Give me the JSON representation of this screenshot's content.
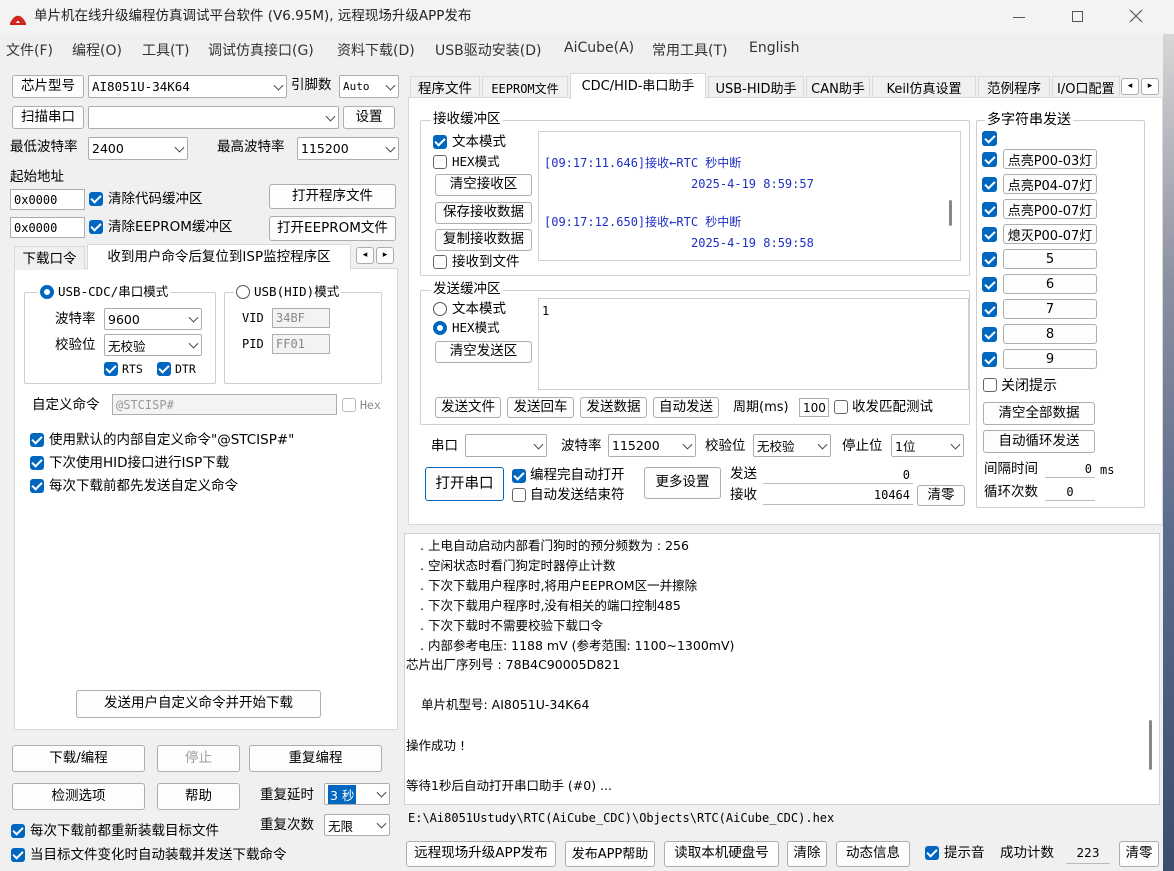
{
  "title": "单片机在线升级编程仿真调试平台软件 (V6.95M), 远程现场升级APP发布",
  "menu": [
    "文件(F)",
    "编程(O)",
    "工具(T)",
    "调试仿真接口(G)",
    "资料下载(D)",
    "USB驱动安装(D)",
    "AiCube(A)",
    "常用工具(T)",
    "English"
  ],
  "left": {
    "chip_label": "芯片型号",
    "chip_value": "AI8051U-34K64",
    "pins_label": "引脚数",
    "pins_value": "Auto",
    "scan_button": "扫描串口",
    "settings_button": "设置",
    "min_baud_label": "最低波特率",
    "min_baud_value": "2400",
    "max_baud_label": "最高波特率",
    "max_baud_value": "115200",
    "start_addr_label": "起始地址",
    "addr1": "0x0000",
    "addr2": "0x0000",
    "clear_code": "清除代码缓冲区",
    "clear_eeprom": "清除EEPROM缓冲区",
    "open_prog": "打开程序文件",
    "open_eeprom": "打开EEPROM文件",
    "tab1": "下载口令",
    "tab2": "收到用户命令后复位到ISP监控程序区",
    "usb_cdc": "USB-CDC/串口模式",
    "usb_hid": "USB(HID)模式",
    "baud_label": "波特率",
    "baud_value": "9600",
    "parity_label": "校验位",
    "parity_value": "无校验",
    "rts": "RTS",
    "dtr": "DTR",
    "vid_label": "VID",
    "vid_value": "34BF",
    "pid_label": "PID",
    "pid_value": "FF01",
    "custom_cmd_label": "自定义命令",
    "custom_cmd_value": "@STCISP#",
    "hex_label": "Hex",
    "opt1": "使用默认的内部自定义命令\"@STCISP#\"",
    "opt2": "下次使用HID接口进行ISP下载",
    "opt3": "每次下载前都先发送自定义命令",
    "send_cmd_button": "发送用户自定义命令并开始下载",
    "download_button": "下载/编程",
    "stop_button": "停止",
    "reprogram_button": "重复编程",
    "check_button": "检测选项",
    "help_button": "帮助",
    "repeat_delay_label": "重复延时",
    "repeat_delay_value": "3 秒",
    "repeat_count_label": "重复次数",
    "repeat_count_value": "无限",
    "reload_before": "每次下载前都重新装载目标文件",
    "auto_reload": "当目标文件变化时自动装载并发送下载命令"
  },
  "tabs": [
    "程序文件",
    "EEPROM文件",
    "CDC/HID-串口助手",
    "USB-HID助手",
    "CAN助手",
    "Keil仿真设置",
    "范例程序",
    "I/O口配置"
  ],
  "serial": {
    "recv_group": "接收缓冲区",
    "text_mode": "文本模式",
    "hex_mode": "HEX模式",
    "clear_recv": "清空接收区",
    "save_recv": "保存接收数据",
    "copy_recv": "复制接收数据",
    "recv_to_file": "接收到文件",
    "recv_lines": [
      "[09:17:11.646]接收←RTC 秒中断",
      "2025-4-19 8:59:57",
      "[09:17:12.650]接收←RTC 秒中断",
      "2025-4-19 8:59:58"
    ],
    "send_group": "发送缓冲区",
    "send_text_mode": "文本模式",
    "send_hex_mode": "HEX模式",
    "clear_send": "清空发送区",
    "send_content": "1",
    "send_file": "发送文件",
    "send_enter": "发送回车",
    "send_data": "发送数据",
    "auto_send": "自动发送",
    "period_label": "周期(ms)",
    "period_value": "100",
    "match_test": "收发匹配测试",
    "port_label": "串口",
    "port_value": "",
    "baud_label": "波特率",
    "baud_value": "115200",
    "parity_label": "校验位",
    "parity_value": "无校验",
    "stop_label": "停止位",
    "stop_value": "1位",
    "open_port": "打开串口",
    "auto_open": "编程完自动打开",
    "auto_send_end": "自动发送结束符",
    "more_settings": "更多设置",
    "send_count_label": "发送",
    "send_count": "0",
    "recv_count_label": "接收",
    "recv_count": "10464",
    "clear_count": "清零"
  },
  "multi": {
    "group": "多字符串发送",
    "items": [
      "点亮P00-03灯",
      "点亮P04-07灯",
      "点亮P00-07灯",
      "熄灭P00-07灯",
      "5",
      "6",
      "7",
      "8",
      "9"
    ],
    "close_tip": "关闭提示",
    "clear_all": "清空全部数据",
    "auto_loop": "自动循环发送",
    "interval_label": "间隔时间",
    "interval_value": "0",
    "interval_unit": "ms",
    "loop_label": "循环次数",
    "loop_value": "0"
  },
  "log": [
    ". 上电自动启动内部看门狗时的预分频数为 : 256",
    ". 空闲状态时看门狗定时器停止计数",
    ". 下次下载用户程序时,将用户EEPROM区一并擦除",
    ". 下次下载用户程序时,没有相关的端口控制485",
    ". 下次下载时不需要校验下载口令",
    ". 内部参考电压: 1188 mV (参考范围: 1100~1300mV)",
    "芯片出厂序列号 : 78B4C90005D821",
    "",
    "单片机型号: AI8051U-34K64",
    "",
    "操作成功 !",
    "",
    "等待1秒后自动打开串口助手 (#0) ..."
  ],
  "status_path": "E:\\Ai8051Ustudy\\RTC(AiCube_CDC)\\Objects\\RTC(AiCube_CDC).hex",
  "bottom": {
    "publish": "远程现场升级APP发布",
    "publish_help": "发布APP帮助",
    "read_disk": "读取本机硬盘号",
    "clear": "清除",
    "dynamic": "动态信息",
    "sound": "提示音",
    "success_label": "成功计数",
    "success_value": "223",
    "reset": "清零"
  }
}
